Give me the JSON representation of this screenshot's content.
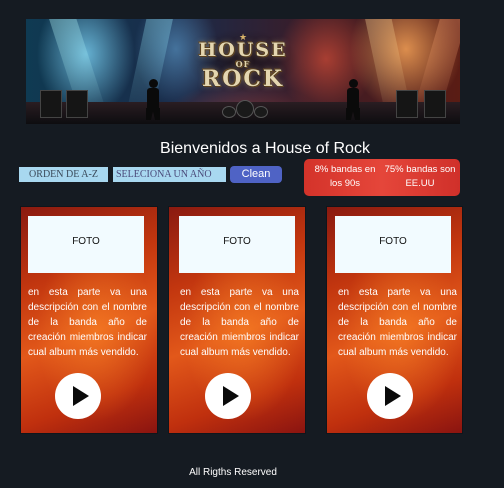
{
  "banner": {
    "logo_line1": "HOUSE",
    "logo_line2": "OF",
    "logo_line3": "ROCK",
    "icon": "concert-stage-image"
  },
  "header": {
    "welcome": "Bienvenidos a House of Rock"
  },
  "controls": {
    "orden_label": "ORDEN DE  A-Z",
    "year_label": "SELECIONA UN AÑO",
    "clean_label": "Clean"
  },
  "stats": {
    "stat1": "8%  bandas en los 90s",
    "stat2": "75%  bandas son EE.UU"
  },
  "cards": [
    {
      "photo_label": "FOTO",
      "description": "en esta parte va una descripción con el nombre de la banda año de creación miembros indicar cual album más vendido.",
      "icon": "play-icon"
    },
    {
      "photo_label": "FOTO",
      "description": "en esta parte va una descripción con el nombre de la banda año de creación miembros indicar cual album más vendido.",
      "icon": "play-icon"
    },
    {
      "photo_label": "FOTO",
      "description": "en esta parte va una descripción con el nombre de la banda año de creación miembros indicar cual album más vendido.",
      "icon": "play-icon"
    }
  ],
  "footer": {
    "text": "All Rigths Reserved"
  },
  "colors": {
    "background": "#151b22",
    "accent_blue": "#4f63c5",
    "filter_bg": "#a8d8f0",
    "stats_red": "#e5463a",
    "card_orange": "#e2581a"
  }
}
